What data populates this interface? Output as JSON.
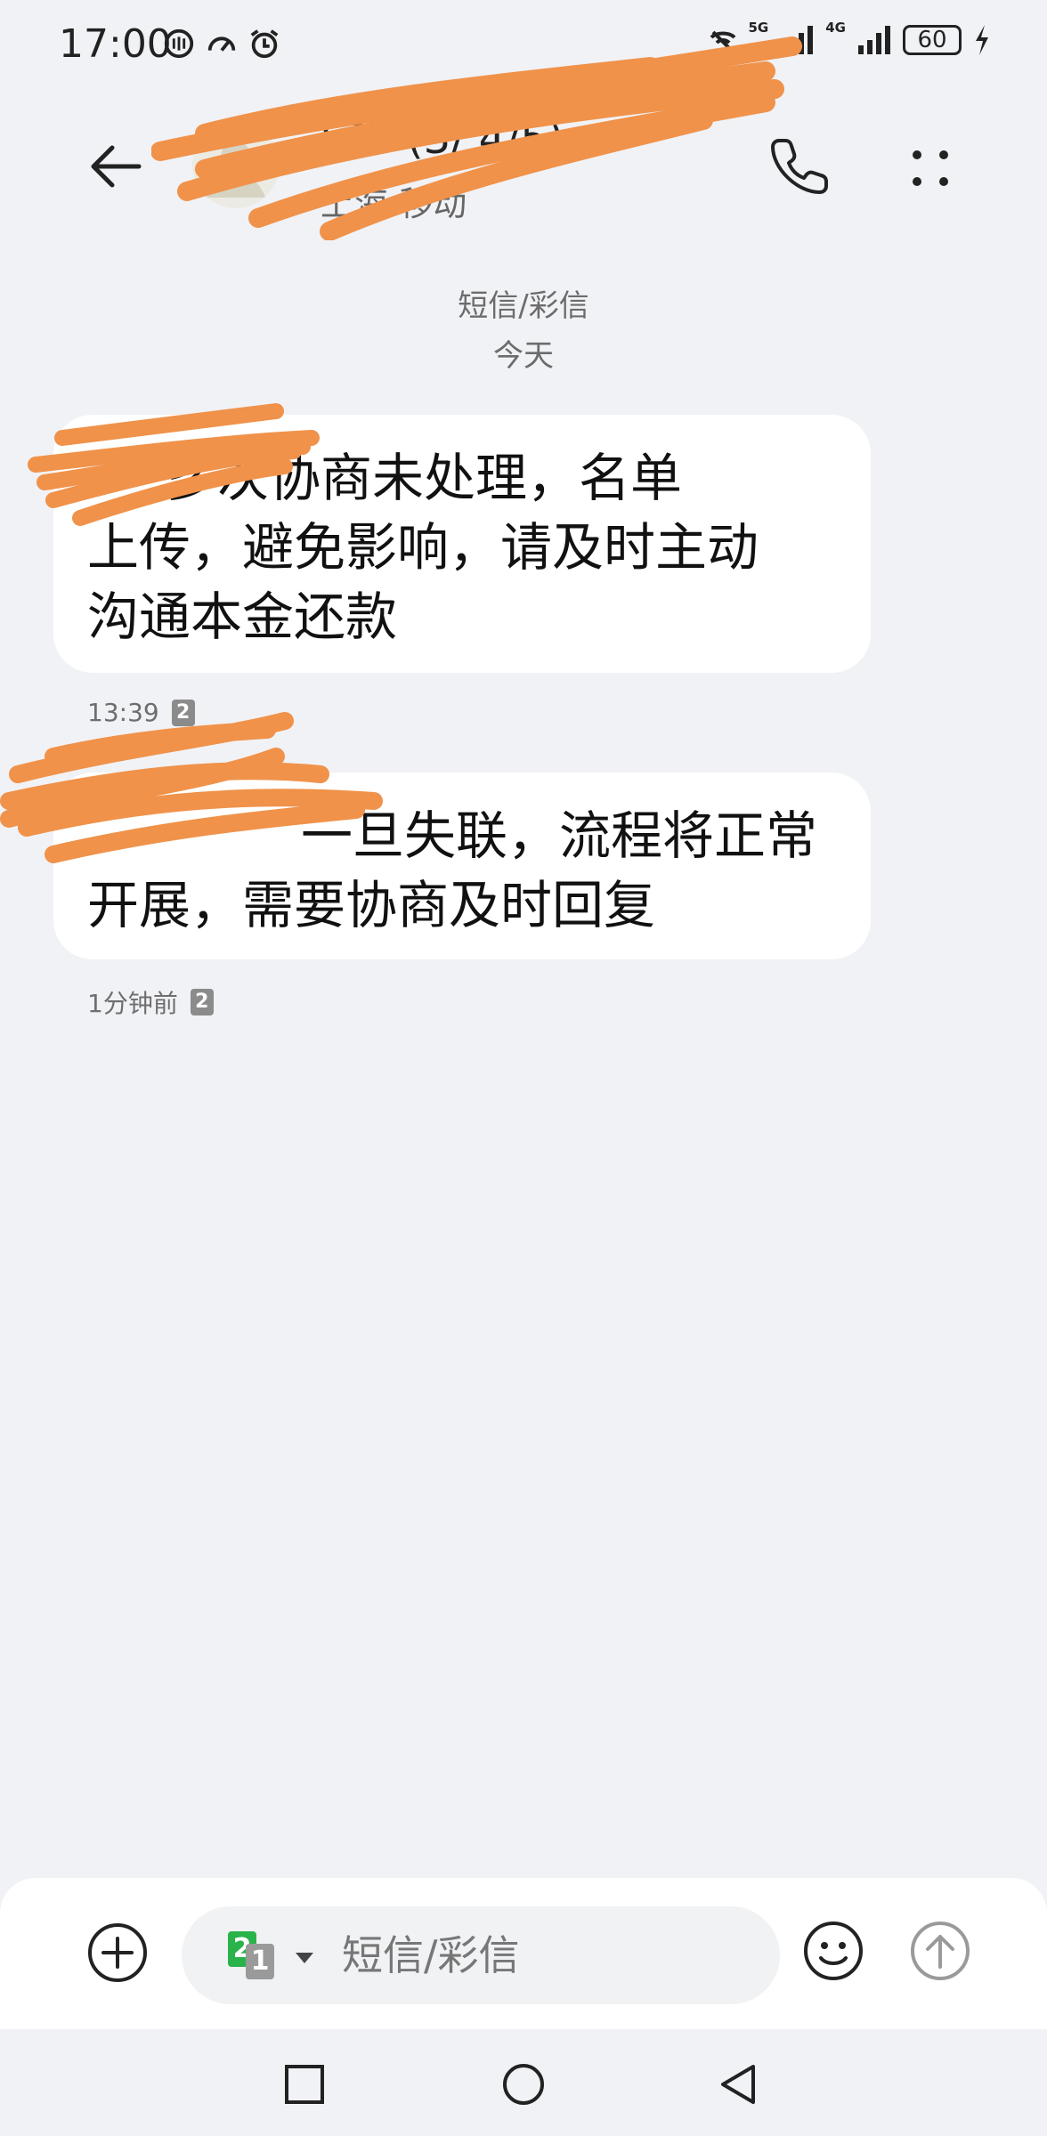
{
  "status_bar": {
    "time": "17:00",
    "network_5g": "5G",
    "network_4g": "4G",
    "battery": "60",
    "icons": [
      "nfc-icon",
      "speed-icon",
      "alarm-icon",
      "mute-icon",
      "signal-icon",
      "signal-icon",
      "charging-icon"
    ]
  },
  "header": {
    "contact_name": "173 (3/ 4/5)",
    "contact_sub": "上海 移动",
    "icons": [
      "back-arrow-icon",
      "avatar-icon",
      "phone-icon",
      "more-dots-icon"
    ]
  },
  "thread": {
    "channel_label": "短信/彩信",
    "date_label": "今天",
    "messages": [
      {
        "lines": [
          "多次协商未处理，名单",
          "上传，避免影响，请及时主动",
          "沟通本金还款"
        ],
        "time": "13:39",
        "sim": "2"
      },
      {
        "lines": [
          "一旦失联，流程将正常",
          "开展，需要协商及时回复"
        ],
        "time": "1分钟前",
        "sim": "2"
      }
    ]
  },
  "composer": {
    "placeholder": "短信/彩信",
    "sim_primary": "2",
    "sim_secondary": "1",
    "icons": [
      "plus-icon",
      "emoji-icon",
      "send-arrow-icon"
    ]
  },
  "accent": {
    "scribble": "#f0924a",
    "sim_green": "#2ab34a"
  }
}
